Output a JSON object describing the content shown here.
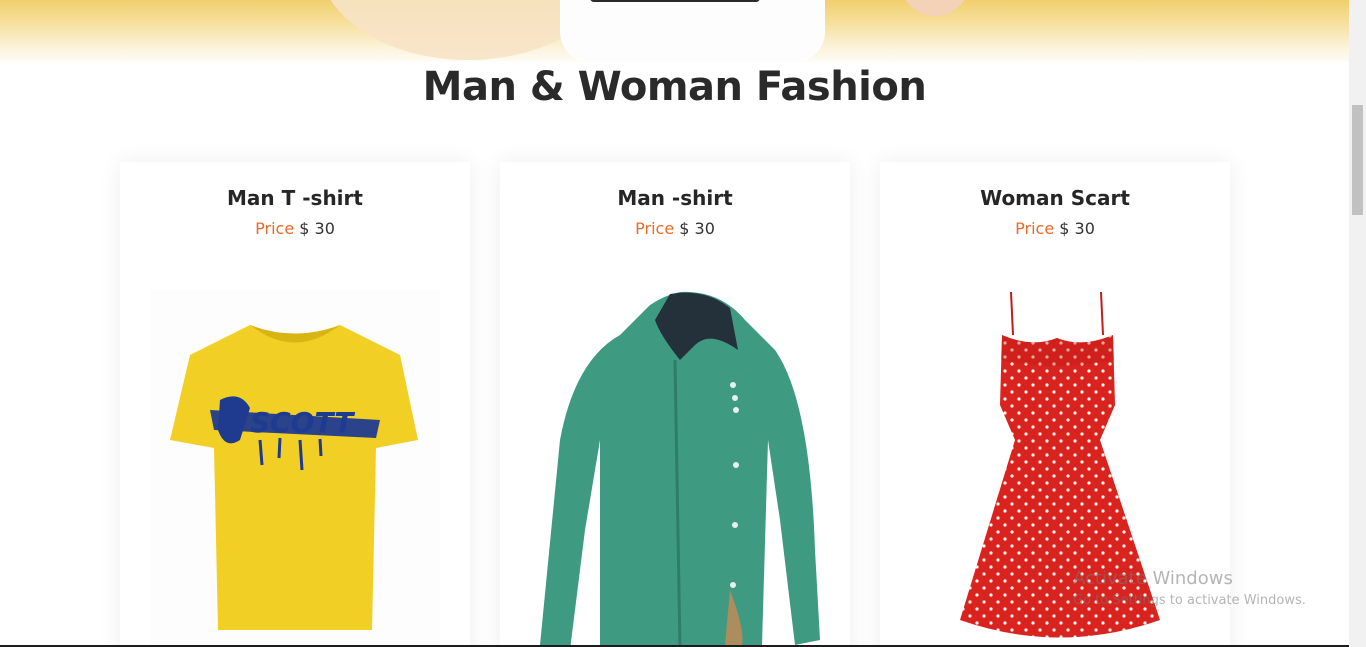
{
  "section": {
    "title": "Man & Woman Fashion"
  },
  "products": [
    {
      "name": "Man T -shirt",
      "price_label": "Price",
      "price_value": "$ 30",
      "image": "yellow-tshirt-image"
    },
    {
      "name": "Man -shirt",
      "price_label": "Price",
      "price_value": "$ 30",
      "image": "green-shirt-image"
    },
    {
      "name": "Woman Scart",
      "price_label": "Price",
      "price_value": "$ 30",
      "image": "red-dress-image"
    }
  ],
  "watermark": {
    "title": "Activate Windows",
    "subtitle": "Go to Settings to activate Windows."
  },
  "colors": {
    "accent": "#e96b2a",
    "heading": "#2a2a2a",
    "tshirt": "#f2cf25",
    "shirt": "#3f9a82",
    "dress": "#d8231f"
  }
}
